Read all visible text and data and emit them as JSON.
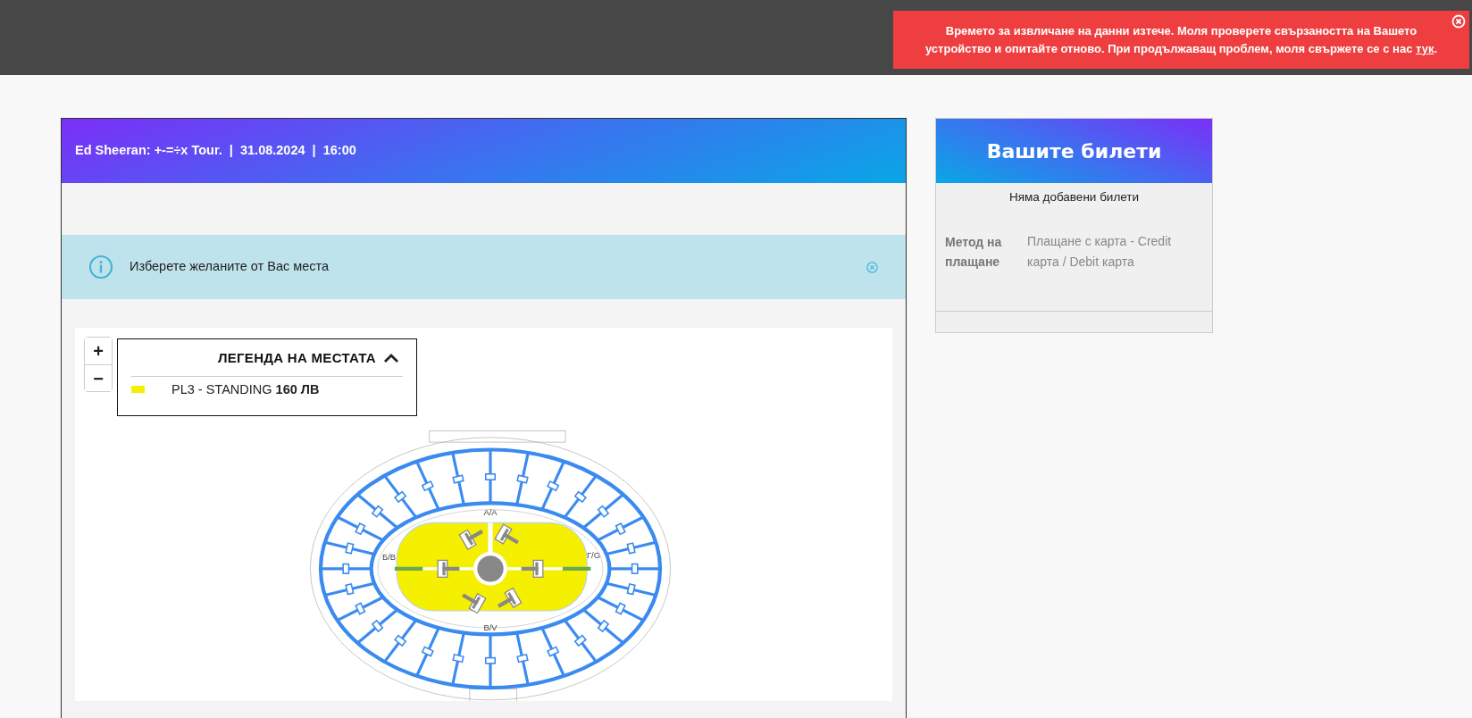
{
  "error_banner": {
    "message": "Времето за извличане на данни изтече. Моля проверете свързаността на Вашето устройство и опитайте отново. При продължаващ проблем, моля свържете се с нас",
    "link": "тук",
    "message_end": "."
  },
  "event_header": {
    "text": "Ed Sheeran: +-=÷x Tour.  |  31.08.2024  |  16:00"
  },
  "alert": {
    "text": "Изберете желаните от Вас места"
  },
  "map": {
    "zoom_buttons": [
      "+",
      "−"
    ],
    "legend": {
      "title": "ЛЕГЕНДА НА МЕСТАТА",
      "expanded": true,
      "items": [
        {
          "name": "PL3 - STANDING",
          "price": "160 ЛВ",
          "color": "#f5ef00"
        }
      ]
    },
    "stand_labels": [
      "А/А",
      "Б/В",
      "В/V",
      "Г/G"
    ]
  },
  "tickets": {
    "title": "Вашите билети",
    "empty": "Няма добавени билети",
    "payment_label": "Метод на плащане",
    "payment_value": "Плащане с карта - Credit карта / Debit карта"
  }
}
